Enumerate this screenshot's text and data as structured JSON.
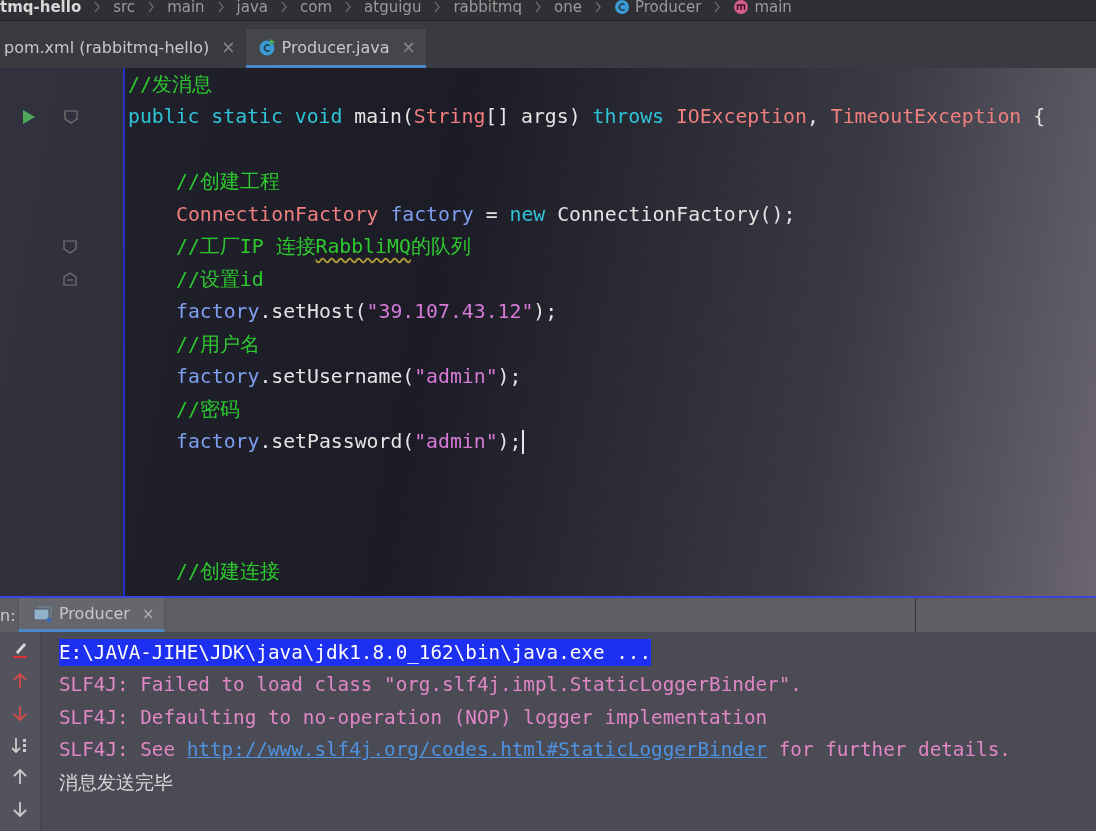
{
  "breadcrumbs": [
    {
      "label": "tmq-hello",
      "kind": "project"
    },
    {
      "label": "src",
      "kind": "folder"
    },
    {
      "label": "main",
      "kind": "folder"
    },
    {
      "label": "java",
      "kind": "folder"
    },
    {
      "label": "com",
      "kind": "folder"
    },
    {
      "label": "atguigu",
      "kind": "folder"
    },
    {
      "label": "rabbitmq",
      "kind": "folder"
    },
    {
      "label": "one",
      "kind": "folder"
    },
    {
      "label": "Producer",
      "kind": "class"
    },
    {
      "label": "main",
      "kind": "method"
    }
  ],
  "editor_tabs": [
    {
      "label": "pom.xml (rabbitmq-hello)",
      "kind": "xml",
      "selected": false,
      "close": "×"
    },
    {
      "label": "Producer.java",
      "kind": "class",
      "selected": true,
      "close": "×"
    }
  ],
  "code": [
    {
      "kind": "code",
      "tokens": [
        {
          "kind": "comment",
          "text": "//发消息"
        }
      ]
    },
    {
      "kind": "code",
      "markers": [
        {
          "kind": "run"
        },
        {
          "kind": "fold"
        }
      ],
      "tokens": [
        {
          "kind": "keyword",
          "text": "public static void"
        },
        {
          "kind": "plain",
          "text": " main("
        },
        {
          "kind": "type",
          "text": "String"
        },
        {
          "kind": "plain",
          "text": "[] args) "
        },
        {
          "kind": "keyword",
          "text": "throws "
        },
        {
          "kind": "type",
          "text": "IOException"
        },
        {
          "kind": "plain",
          "text": ", "
        },
        {
          "kind": "type",
          "text": "TimeoutException"
        },
        {
          "kind": "plain",
          "text": " {"
        }
      ],
      "children": [
        {
          "kind": "blank"
        },
        {
          "kind": "code",
          "tokens": [
            {
              "kind": "comment",
              "text": "//创建工程"
            }
          ]
        },
        {
          "kind": "code",
          "tokens": [
            {
              "kind": "type",
              "text": "ConnectionFactory "
            },
            {
              "kind": "var",
              "text": "factory"
            },
            {
              "kind": "plain",
              "text": " = "
            },
            {
              "kind": "keyword",
              "text": "new"
            },
            {
              "kind": "plain",
              "text": " ConnectionFactory();"
            }
          ]
        },
        {
          "kind": "code",
          "markers": [
            {
              "kind": "fold"
            }
          ],
          "tokens": [
            {
              "kind": "comment",
              "text": "//工厂IP 连接"
            },
            {
              "kind": "comment",
              "text": "RabbliMQ",
              "typo": true
            },
            {
              "kind": "comment",
              "text": "的队列"
            }
          ]
        },
        {
          "kind": "code",
          "markers": [
            {
              "kind": "fold-end"
            }
          ],
          "tokens": [
            {
              "kind": "comment",
              "text": "//设置id"
            }
          ]
        },
        {
          "kind": "code",
          "tokens": [
            {
              "kind": "var",
              "text": "factory"
            },
            {
              "kind": "plain",
              "text": ".setHost("
            },
            {
              "kind": "string",
              "text": "\"39.107.43.12\""
            },
            {
              "kind": "plain",
              "text": ");"
            }
          ]
        },
        {
          "kind": "code",
          "tokens": [
            {
              "kind": "comment",
              "text": "//用户名"
            }
          ]
        },
        {
          "kind": "code",
          "tokens": [
            {
              "kind": "var",
              "text": "factory"
            },
            {
              "kind": "plain",
              "text": ".setUsername("
            },
            {
              "kind": "string",
              "text": "\"admin\""
            },
            {
              "kind": "plain",
              "text": ");"
            }
          ]
        },
        {
          "kind": "code",
          "tokens": [
            {
              "kind": "comment",
              "text": "//密码"
            }
          ]
        },
        {
          "kind": "code",
          "caret": true,
          "tokens": [
            {
              "kind": "var",
              "text": "factory"
            },
            {
              "kind": "plain",
              "text": ".setPassword("
            },
            {
              "kind": "string",
              "text": "\"admin\""
            },
            {
              "kind": "plain",
              "text": ");"
            }
          ]
        },
        {
          "kind": "blank"
        },
        {
          "kind": "blank"
        },
        {
          "kind": "blank"
        },
        {
          "kind": "code",
          "tokens": [
            {
              "kind": "comment",
              "text": "//创建连接"
            }
          ]
        }
      ]
    }
  ],
  "run_panel": {
    "label": "n:",
    "tabs": [
      {
        "label": "Producer",
        "selected": true,
        "close": "×"
      }
    ],
    "toolbar": [
      {
        "kind": "clear"
      },
      {
        "kind": "up-red"
      },
      {
        "kind": "down-red"
      },
      {
        "kind": "sort"
      },
      {
        "kind": "up"
      },
      {
        "kind": "down"
      }
    ],
    "console": [
      {
        "highlighted": true,
        "segments": [
          {
            "kind": "command",
            "text": "E:\\JAVA-JIHE\\JDK\\java\\jdk1.8.0_162\\bin\\java.exe ..."
          }
        ]
      },
      {
        "highlighted": false,
        "segments": [
          {
            "kind": "error",
            "text": "SLF4J: Failed to load class \"org.slf4j.impl.StaticLoggerBinder\"."
          }
        ]
      },
      {
        "highlighted": false,
        "segments": [
          {
            "kind": "error",
            "text": "SLF4J: Defaulting to no-operation (NOP) logger implementation"
          }
        ]
      },
      {
        "highlighted": false,
        "segments": [
          {
            "kind": "error",
            "text": "SLF4J: See "
          },
          {
            "kind": "link",
            "text": "http://www.slf4j.org/codes.html#StaticLoggerBinder"
          },
          {
            "kind": "error",
            "text": " for further details."
          }
        ]
      },
      {
        "highlighted": false,
        "segments": [
          {
            "kind": "output",
            "text": "消息发送完毕"
          }
        ]
      }
    ]
  }
}
